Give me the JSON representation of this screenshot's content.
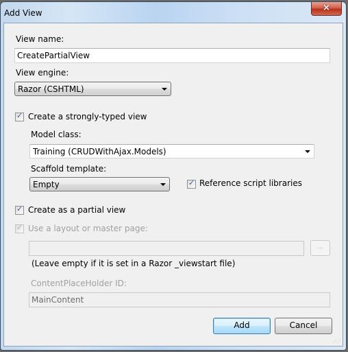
{
  "window": {
    "title": "Add View",
    "close_icon": "×"
  },
  "view_name": {
    "label": "View name:",
    "value": "CreatePartialView"
  },
  "view_engine": {
    "label": "View engine:",
    "selected": "Razor (CSHTML)"
  },
  "strongly_typed": {
    "label": "Create a strongly-typed view",
    "checked": true
  },
  "model_class": {
    "label": "Model class:",
    "selected": "Training (CRUDWithAjax.Models)"
  },
  "scaffold_template": {
    "label": "Scaffold template:",
    "selected": "Empty"
  },
  "reference_scripts": {
    "label": "Reference script libraries",
    "checked": true
  },
  "partial_view": {
    "label": "Create as a partial view",
    "checked": true
  },
  "use_layout": {
    "label": "Use a layout or master page:",
    "checked": true,
    "enabled": false
  },
  "layout_path": {
    "value": "",
    "browse_label": "...",
    "hint": "(Leave empty if it is set in a Razor _viewstart file)"
  },
  "content_placeholder": {
    "label": "ContentPlaceHolder ID:",
    "value": "MainContent"
  },
  "buttons": {
    "add": "Add",
    "cancel": "Cancel"
  },
  "check_glyph": "✓"
}
